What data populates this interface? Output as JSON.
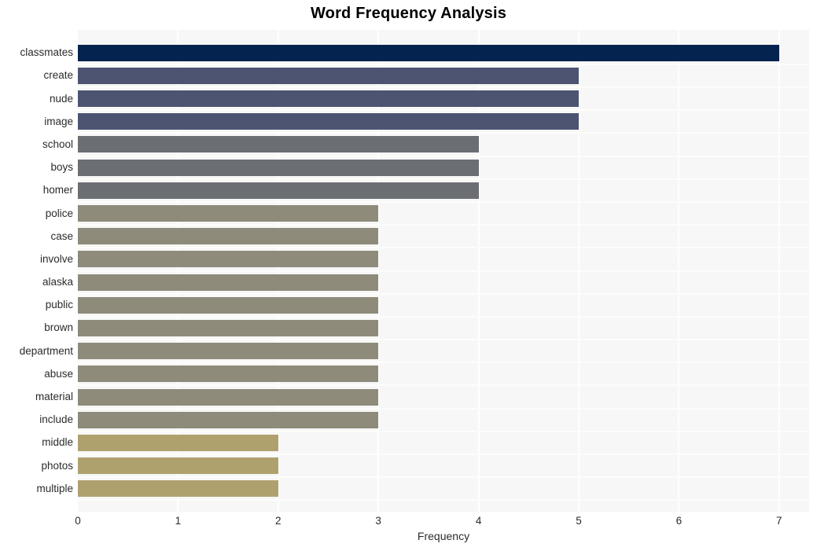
{
  "chart_data": {
    "type": "bar",
    "orientation": "horizontal",
    "title": "Word Frequency Analysis",
    "xlabel": "Frequency",
    "ylabel": "",
    "xlim": [
      0,
      7.3
    ],
    "xticks": [
      0,
      1,
      2,
      3,
      4,
      5,
      6,
      7
    ],
    "xtick_labels": [
      "0",
      "1",
      "2",
      "3",
      "4",
      "5",
      "6",
      "7"
    ],
    "grid": true,
    "grid_color": "#ffffff",
    "plot_background": "#f7f7f7",
    "legend": null,
    "categories": [
      "classmates",
      "create",
      "nude",
      "image",
      "school",
      "boys",
      "homer",
      "police",
      "case",
      "involve",
      "alaska",
      "public",
      "brown",
      "department",
      "abuse",
      "material",
      "include",
      "middle",
      "photos",
      "multiple"
    ],
    "values": [
      7,
      5,
      5,
      5,
      4,
      4,
      4,
      3,
      3,
      3,
      3,
      3,
      3,
      3,
      3,
      3,
      3,
      2,
      2,
      2
    ],
    "bar_colors": [
      "#04244f",
      "#4c5472",
      "#4c5472",
      "#4c5472",
      "#6b6e73",
      "#6b6e73",
      "#6b6e73",
      "#8e8b7a",
      "#8e8b7a",
      "#8e8b7a",
      "#8e8b7a",
      "#8e8b7a",
      "#8e8b7a",
      "#8e8b7a",
      "#8e8b7a",
      "#8e8b7a",
      "#8e8b7a",
      "#afa16e",
      "#afa16e",
      "#afa16e"
    ]
  }
}
